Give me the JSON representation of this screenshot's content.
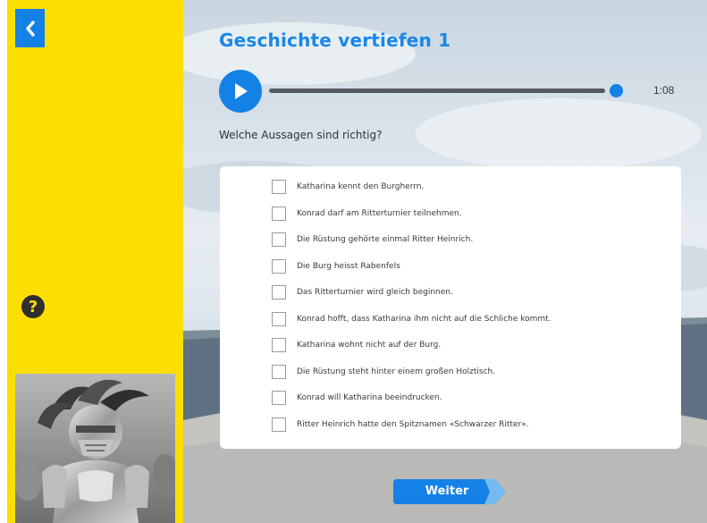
{
  "colors": {
    "sidebar": "#fcdf00",
    "accent_blue": "#1481e6",
    "title_blue": "#1a87e8",
    "progress_track": "#555a60"
  },
  "navigation": {
    "back_icon": "chevron-left-icon",
    "help_label": "?"
  },
  "exercise": {
    "title": "Geschichte vertiefen 1",
    "question": "Welche Aussagen sind richtig?"
  },
  "audio": {
    "play_icon": "play-icon",
    "duration": "1:08",
    "progress": 0.97
  },
  "answers": [
    {
      "label": "Katharina kennt den Burgherrn.",
      "checked": false
    },
    {
      "label": "Konrad darf am Ritterturnier teilnehmen.",
      "checked": false
    },
    {
      "label": "Die Rüstung gehörte einmal Ritter Heinrich.",
      "checked": false
    },
    {
      "label": "Die Burg heisst Rabenfels",
      "checked": false
    },
    {
      "label": "Das Ritterturnier wird gleich beginnen.",
      "checked": false
    },
    {
      "label": "Konrad hofft, dass Katharina ihm nicht auf die Schliche kommt.",
      "checked": false
    },
    {
      "label": "Katharina wohnt nicht auf der Burg.",
      "checked": false
    },
    {
      "label": "Die Rüstung steht hinter einem großen Holztisch.",
      "checked": false
    },
    {
      "label": "Konrad will Katharina beeindrucken.",
      "checked": false
    },
    {
      "label": "Ritter Heinrich hatte den Spitznamen «Schwarzer Ritter».",
      "checked": false
    }
  ],
  "footer": {
    "next_label": "Weiter"
  }
}
